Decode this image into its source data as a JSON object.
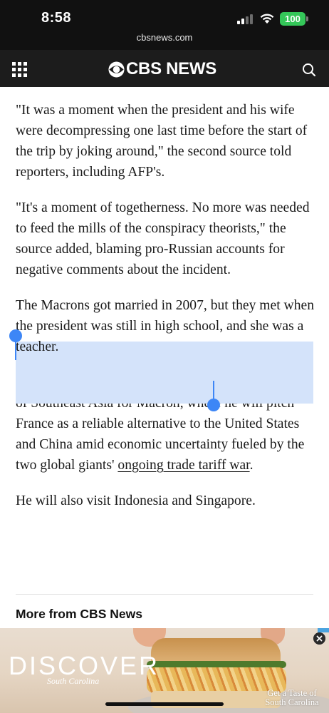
{
  "status_bar": {
    "time": "8:58",
    "battery": "100",
    "url": "cbsnews.com"
  },
  "header": {
    "logo_text": "CBS NEWS",
    "menu_icon": "grid-menu-icon",
    "search_icon": "search-icon"
  },
  "article": {
    "paragraphs": [
      "\"It was a moment when the president and his wife were decompressing one last time before the start of the trip by joking around,\" the second source told reporters, including AFP's.",
      "\"It's a moment of togetherness. No more was needed to feed the mills of the conspiracy theorists,\" the source added, blaming pro-Russian accounts for negative comments about the incident.",
      "The Macrons got married in 2007, but they met when the president was still in high school, and she was a teacher.",
      "He will also visit Indonesia and Singapore."
    ],
    "vietnam_para_before": "Vietnam is the first stop on an almost week-long tour of Southeast Asia for Macron, where he will pitch France as a reliable alternative to the United States and China amid economic uncertainty fueled by the two global giants' ",
    "vietnam_link": "ongoing trade tariff war",
    "vietnam_para_after": "."
  },
  "more_from": "More from CBS News",
  "ad": {
    "brand": "DISCOVER",
    "brand_sub": "South Carolina",
    "tagline": "Get a Taste of South Carolina"
  },
  "colors": {
    "selection": "#d4e3fa",
    "handle": "#3d86f6",
    "battery": "#34c759",
    "header_bg": "#1c1c1c"
  }
}
